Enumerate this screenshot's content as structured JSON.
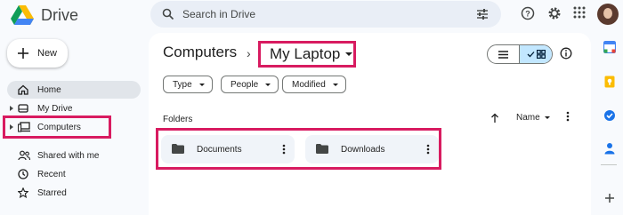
{
  "app": {
    "name": "Drive"
  },
  "search": {
    "placeholder": "Search in Drive"
  },
  "sidebar": {
    "new_label": "New",
    "items": [
      {
        "label": "Home",
        "icon": "home-icon"
      },
      {
        "label": "My Drive",
        "icon": "drive-icon"
      },
      {
        "label": "Computers",
        "icon": "computers-icon"
      },
      {
        "label": "Shared with me",
        "icon": "shared-icon"
      },
      {
        "label": "Recent",
        "icon": "clock-icon"
      },
      {
        "label": "Starred",
        "icon": "star-icon"
      }
    ]
  },
  "breadcrumb": {
    "root": "Computers",
    "current": "My Laptop"
  },
  "filters": [
    "Type",
    "People",
    "Modified"
  ],
  "section": {
    "title": "Folders",
    "sort_label": "Name"
  },
  "folders": [
    {
      "name": "Documents"
    },
    {
      "name": "Downloads"
    }
  ],
  "colors": {
    "highlight": "#d81b60",
    "selected_view": "#c2e7ff",
    "background": "#f8fafd"
  }
}
